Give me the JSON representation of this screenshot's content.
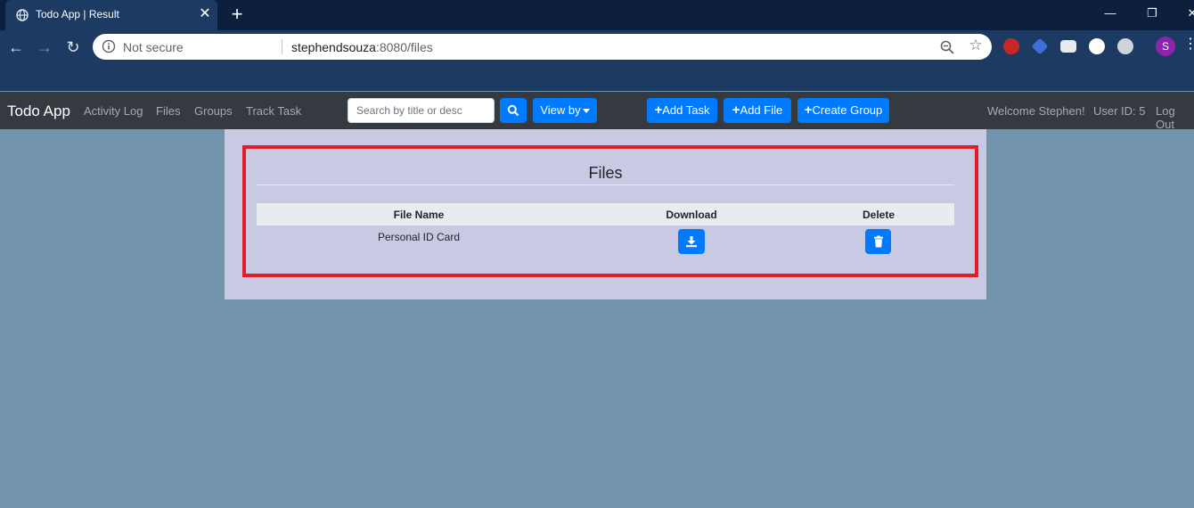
{
  "browser": {
    "tab_title": "Todo App | Result",
    "new_tab": "+",
    "close_tab": "✕",
    "security_label": "Not secure",
    "url_host": "stephendsouza",
    "url_rest": ":8080/files",
    "profile_initial": "S"
  },
  "navbar": {
    "brand": "Todo App",
    "links": [
      "Activity Log",
      "Files",
      "Groups",
      "Track Task"
    ],
    "search_placeholder": "Search by title or desc",
    "view_by": "View by",
    "add_task": "Add Task",
    "add_file": "Add File",
    "create_group": "Create Group",
    "welcome": "Welcome Stephen!",
    "user_id": "User ID: 5",
    "logout": "Log Out"
  },
  "files": {
    "title": "Files",
    "columns": [
      "File Name",
      "Download",
      "Delete"
    ],
    "rows": [
      {
        "file_name": "Personal ID Card"
      }
    ]
  },
  "colors": {
    "accent": "#007bff",
    "highlight_border": "#e21c2a",
    "page_bg": "#7193ac",
    "panel_bg": "#c8cae3",
    "navbar_bg": "#343a40"
  },
  "icons": [
    "globe-icon",
    "back-arrow-icon",
    "forward-arrow-icon",
    "reload-icon",
    "info-icon",
    "zoom-icon",
    "star-icon",
    "search-icon",
    "plus-icon",
    "download-icon",
    "trash-icon"
  ]
}
